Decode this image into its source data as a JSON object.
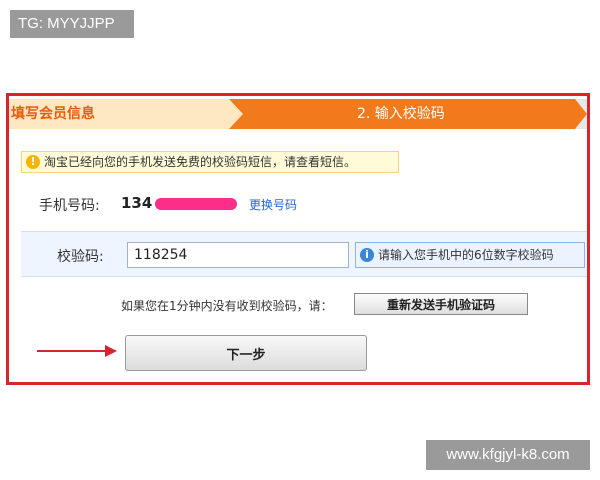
{
  "watermarks": {
    "top": "TG: MYYJJPP",
    "bottom": "www.kfgjyl-k8.com"
  },
  "steps": {
    "step1": "填写会员信息",
    "step2": "2. 输入校验码"
  },
  "notice": {
    "icon": "!",
    "text": "淘宝已经向您的手机发送免费的校验码短信，请查看短信。"
  },
  "phone": {
    "label": "手机号码:",
    "value": "134",
    "change_link": "更换号码"
  },
  "code": {
    "label": "校验码:",
    "value": "118254",
    "hint_icon": "i",
    "hint": "请输入您手机中的6位数字校验码"
  },
  "resend": {
    "text": "如果您在1分钟内没有收到校验码，请：",
    "button": "重新发送手机验证码"
  },
  "next_button": "下一步",
  "colors": {
    "frame_border": "#d9232d",
    "step_active": "#f07a1c",
    "step_done": "#fde8c2",
    "phone_mask": "#ff2d8a"
  }
}
